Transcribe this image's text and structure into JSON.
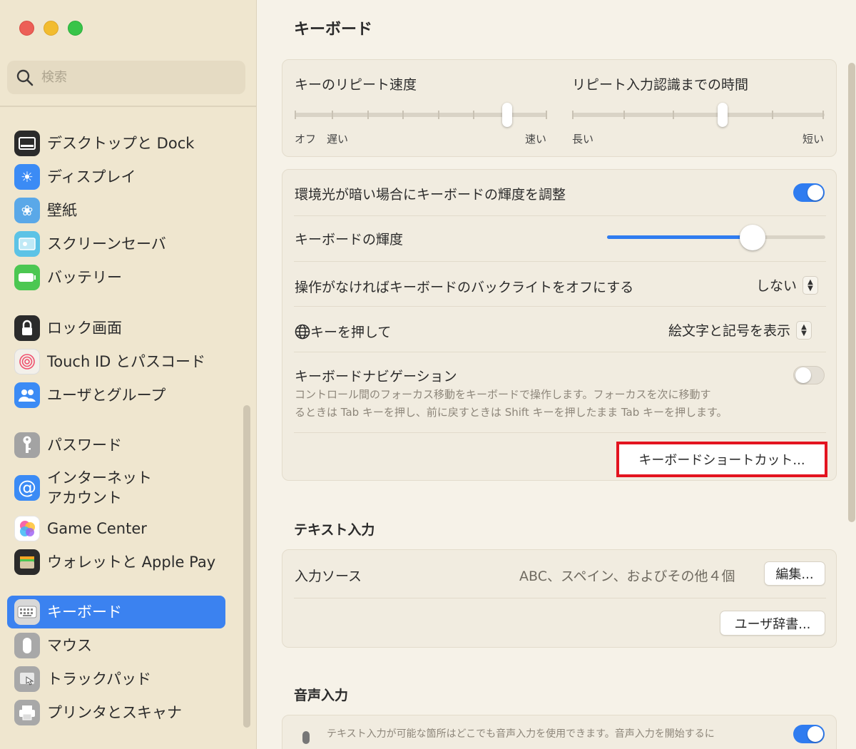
{
  "window": {
    "title": "キーボード"
  },
  "search": {
    "placeholder": "検索"
  },
  "sidebar": {
    "items": [
      {
        "label": "デスクトップと Dock",
        "icon": "dock-icon",
        "color": "#2b2b2b"
      },
      {
        "label": "ディスプレイ",
        "icon": "display-sun-icon",
        "color": "#3b8bf5"
      },
      {
        "label": "壁紙",
        "icon": "wallpaper-flower-icon",
        "color": "#5aa8e8"
      },
      {
        "label": "スクリーンセーバ",
        "icon": "screensaver-icon",
        "color": "#5cc3e6"
      },
      {
        "label": "バッテリー",
        "icon": "battery-icon",
        "color": "#4cc752"
      },
      {
        "label": "ロック画面",
        "icon": "lock-icon",
        "color": "#2b2b2b"
      },
      {
        "label": "Touch ID とパスコード",
        "icon": "fingerprint-icon",
        "color": "#f3f0ea"
      },
      {
        "label": "ユーザとグループ",
        "icon": "users-icon",
        "color": "#3b8bf5"
      },
      {
        "label": "パスワード",
        "icon": "key-icon",
        "color": "#9a9a9a"
      },
      {
        "label": "インターネット\nアカウント",
        "label1": "インターネット",
        "label2": "アカウント",
        "icon": "at-sign-icon",
        "color": "#3b8bf5"
      },
      {
        "label": "Game Center",
        "icon": "game-center-icon",
        "color": "#ffffff"
      },
      {
        "label": "ウォレットと Apple Pay",
        "icon": "wallet-icon",
        "color": "#2b2b2b"
      },
      {
        "label": "キーボード",
        "icon": "keyboard-icon",
        "color": "#a8a8a8",
        "selected": true
      },
      {
        "label": "マウス",
        "icon": "mouse-icon",
        "color": "#a8a8a8"
      },
      {
        "label": "トラックパッド",
        "icon": "trackpad-icon",
        "color": "#a8a8a8"
      },
      {
        "label": "プリンタとスキャナ",
        "icon": "printer-icon",
        "color": "#a8a8a8"
      }
    ]
  },
  "repeat": {
    "key_repeat_label": "キーのリピート速度",
    "key_repeat_off": "オフ",
    "key_repeat_slow": "遅い",
    "key_repeat_fast": "速い",
    "key_repeat_value": 0.8,
    "delay_label": "リピート入力認識までの時間",
    "delay_long": "長い",
    "delay_short": "短い",
    "delay_value": 0.6
  },
  "backlight": {
    "adjust_label": "環境光が暗い場合にキーボードの輝度を調整",
    "adjust_on": true,
    "brightness_label": "キーボードの輝度",
    "brightness_value": 0.67,
    "off_label": "操作がなければキーボードのバックライトをオフにする",
    "off_value": "しない",
    "globe_label": "キーを押して",
    "globe_value": "絵文字と記号を表示",
    "nav_label": "キーボードナビゲーション",
    "nav_on": false,
    "nav_desc1": "コントロール間のフォーカス移動をキーボードで操作します。フォーカスを次に移動す",
    "nav_desc2": "るときは Tab キーを押し、前に戻すときは Shift キーを押したまま Tab キーを押します。",
    "shortcuts_button": "キーボードショートカット..."
  },
  "text_input": {
    "title": "テキスト入力",
    "source_label": "入力ソース",
    "source_value": "ABC、スペイン、およびその他４個",
    "edit_button": "編集...",
    "dict_button": "ユーザ辞書..."
  },
  "voice": {
    "title": "音声入力",
    "desc": "テキスト入力が可能な箇所はどこでも音声入力を使用できます。音声入力を開始するに",
    "on": true
  },
  "colors": {
    "accent": "#2f7cf0",
    "selection": "#3b82f0",
    "highlight_border": "#e3141f"
  }
}
